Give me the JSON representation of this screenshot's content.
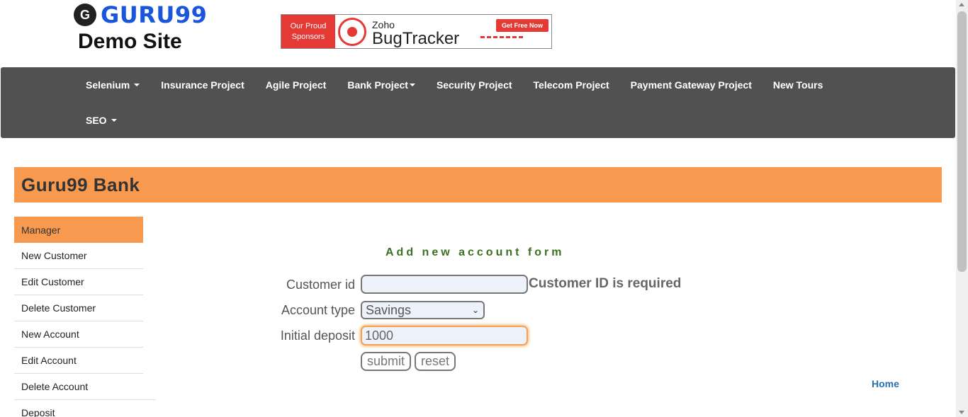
{
  "logo": {
    "icon_glyph": "G",
    "brand": "GURU99",
    "subtitle": "Demo Site"
  },
  "banner": {
    "left_line1": "Our Proud",
    "left_line2": "Sponsors",
    "vendor": "Zoho",
    "product": "BugTracker",
    "cta": "Get Free Now",
    "icon": "bug-icon",
    "color": "#e53935"
  },
  "nav": {
    "items": [
      {
        "label": "Selenium",
        "dropdown": true
      },
      {
        "label": "Insurance Project",
        "dropdown": false
      },
      {
        "label": "Agile Project",
        "dropdown": false
      },
      {
        "label": "Bank Project",
        "dropdown": true
      },
      {
        "label": "Security Project",
        "dropdown": false
      },
      {
        "label": "Telecom Project",
        "dropdown": false
      },
      {
        "label": "Payment Gateway Project",
        "dropdown": false
      },
      {
        "label": "New Tours",
        "dropdown": false
      },
      {
        "label": "SEO",
        "dropdown": true
      }
    ],
    "background": "#515151"
  },
  "bank": {
    "title": "Guru99 Bank",
    "accent": "#f7994e"
  },
  "sidebar": {
    "items": [
      {
        "label": "Manager",
        "active": true
      },
      {
        "label": "New Customer",
        "active": false
      },
      {
        "label": "Edit Customer",
        "active": false
      },
      {
        "label": "Delete Customer",
        "active": false
      },
      {
        "label": "New Account",
        "active": false
      },
      {
        "label": "Edit Account",
        "active": false
      },
      {
        "label": "Delete Account",
        "active": false
      },
      {
        "label": "Deposit",
        "active": false
      }
    ]
  },
  "form": {
    "title": "Add new account form",
    "customer_id_label": "Customer id",
    "customer_id_value": "",
    "customer_id_error": "Customer ID is required",
    "account_type_label": "Account type",
    "account_type_selected": "Savings",
    "initial_deposit_label": "Initial deposit",
    "initial_deposit_value": "1000",
    "submit_label": "submit",
    "reset_label": "reset"
  },
  "footer": {
    "home_link": "Home"
  }
}
